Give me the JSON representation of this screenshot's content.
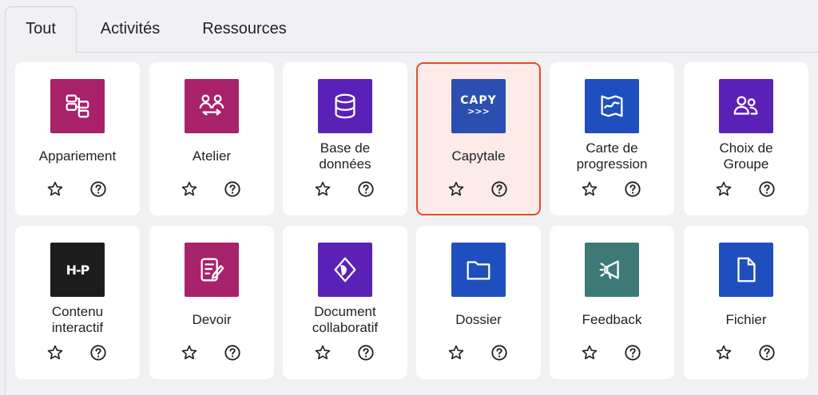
{
  "tabs": [
    {
      "label": "Tout",
      "active": true
    },
    {
      "label": "Activités",
      "active": false
    },
    {
      "label": "Ressources",
      "active": false
    }
  ],
  "colors": {
    "magenta": "#a8216b",
    "purple": "#5b21b6",
    "blue": "#1f4fbf",
    "teal": "#3e7a75",
    "dark": "#1d1d1d",
    "selected_border": "#e8492d",
    "selected_bg": "#fcebe8"
  },
  "modules": [
    {
      "name": [
        "Appariement"
      ],
      "icon": "matching-icon",
      "color": "#a8216b"
    },
    {
      "name": [
        "Atelier"
      ],
      "icon": "workshop-icon",
      "color": "#a8216b"
    },
    {
      "name": [
        "Base de",
        "données"
      ],
      "icon": "database-icon",
      "color": "#5b21b6"
    },
    {
      "name": [
        "Capytale"
      ],
      "icon": "capytale-icon",
      "color": "#2b4fb0",
      "icon_text": [
        "CAPY",
        ">>>"
      ],
      "selected": true
    },
    {
      "name": [
        "Carte de",
        "progression"
      ],
      "icon": "map-icon",
      "color": "#1f4fbf"
    },
    {
      "name": [
        "Choix de",
        "Groupe"
      ],
      "icon": "group-choice-icon",
      "color": "#5b21b6"
    },
    {
      "name": [
        "Contenu",
        "interactif"
      ],
      "icon": "h5p-icon",
      "color": "#1d1d1d",
      "icon_text": [
        "H-P"
      ]
    },
    {
      "name": [
        "Devoir"
      ],
      "icon": "assignment-icon",
      "color": "#a8216b"
    },
    {
      "name": [
        "Document",
        "collaboratif"
      ],
      "icon": "collaborative-doc-icon",
      "color": "#5b21b6"
    },
    {
      "name": [
        "Dossier"
      ],
      "icon": "folder-icon",
      "color": "#1f4fbf"
    },
    {
      "name": [
        "Feedback"
      ],
      "icon": "feedback-icon",
      "color": "#3e7a75"
    },
    {
      "name": [
        "Fichier"
      ],
      "icon": "file-icon",
      "color": "#1f4fbf"
    }
  ]
}
